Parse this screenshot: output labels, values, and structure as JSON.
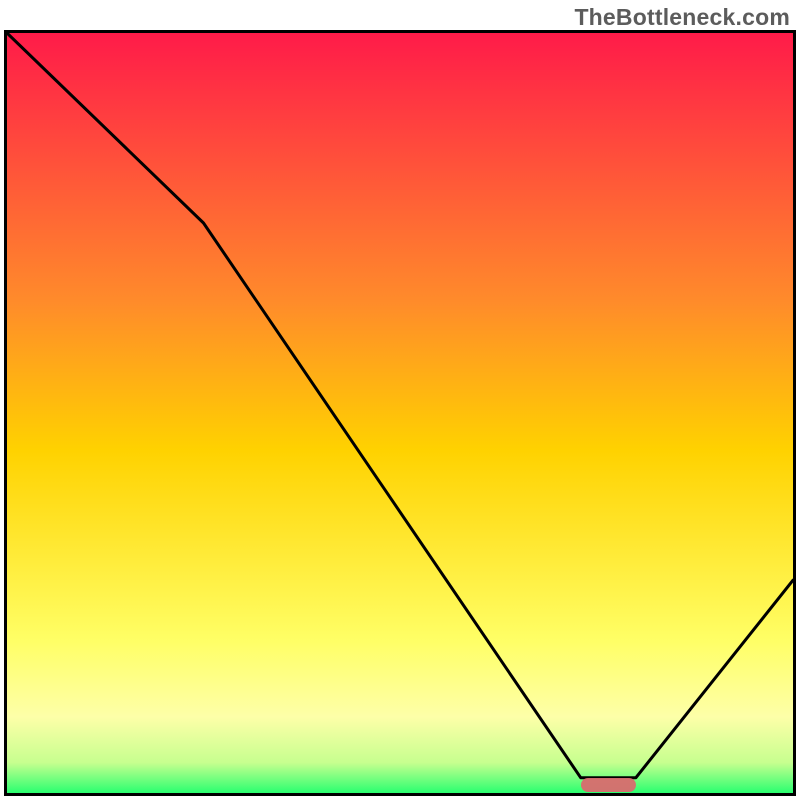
{
  "watermark": "TheBottleneck.com",
  "chart_data": {
    "type": "line",
    "title": "",
    "xlabel": "",
    "ylabel": "",
    "xlim": [
      0,
      100
    ],
    "ylim": [
      0,
      100
    ],
    "grid": false,
    "series": [
      {
        "name": "curve",
        "x": [
          0,
          25,
          73,
          80,
          100
        ],
        "values": [
          100,
          75,
          2,
          2,
          28
        ]
      }
    ],
    "marker": {
      "x_start": 73,
      "x_end": 80,
      "y": 1
    },
    "gradient_stops": [
      {
        "offset": 0.0,
        "color": "#ff1b49"
      },
      {
        "offset": 0.35,
        "color": "#ff8a2b"
      },
      {
        "offset": 0.55,
        "color": "#ffd200"
      },
      {
        "offset": 0.8,
        "color": "#ffff66"
      },
      {
        "offset": 0.9,
        "color": "#fdffa8"
      },
      {
        "offset": 0.96,
        "color": "#c7ff8f"
      },
      {
        "offset": 1.0,
        "color": "#2aff70"
      }
    ]
  }
}
